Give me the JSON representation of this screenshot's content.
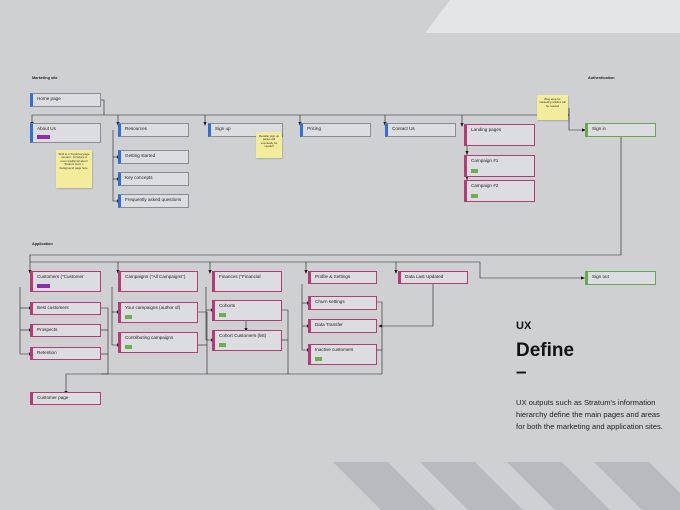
{
  "sections": {
    "marketing": "Marketing site",
    "authentication": "Authentication",
    "application": "Application"
  },
  "nodes": {
    "home": "Home page",
    "about": "About Us",
    "resources": "Resources",
    "getting_started": "Getting started",
    "key_concepts": "Key concepts",
    "faq": "Frequently asked questions",
    "sign_up": "Sign up",
    "pricing": "Pricing",
    "contact": "Contact Us",
    "landing": "Landing pages",
    "campaign1": "Campaign #1",
    "campaign2": "Campaign #2",
    "sign_in": "Sign in",
    "customers": "Customers (\"Customer",
    "best": "Best customers",
    "prospects": "Prospects",
    "retention": "Retention",
    "campaigns": "Campaigns (\"All Campaigns\")",
    "your_campaigns": "Your campaigns (author of)",
    "contributing": "Contributing campaigns",
    "finances": "Finances (\"Financial",
    "cohorts": "Cohorts",
    "cohort_customers": "Cohort Customers (list)",
    "profile": "Profile & Settings",
    "churn": "Churn settings",
    "data_transfer": "Data Transfer",
    "inactive": "Inactive customers",
    "data_last_updated": "Data Last Updated",
    "sign_out": "Sign out",
    "customer_page": "Customer page"
  },
  "notes": {
    "about_note": "Shift to a 'Features' page needed - introduce a more traditional about Stratum team + background page here.",
    "signup_note": "Reseller sign up pages will eventually be needed",
    "blog_note": "Blog area for marketing articles will be needed"
  },
  "panel": {
    "tag": "UX",
    "title": "Define",
    "dash": "–",
    "description": "UX outputs such as Stratum's information hierarchy define the main pages and areas for both the marketing and application sites."
  },
  "colors": {
    "background": "#cfd0d2",
    "box_fill": "#dcdde0",
    "marketing_accent": "#2f6fd6",
    "app_accent": "#b43a78",
    "auth_accent": "#6aa84f",
    "swatch_green": "#6ab04c",
    "swatch_purple": "#8e2bb0",
    "sticky_note": "#f3ec9b"
  }
}
